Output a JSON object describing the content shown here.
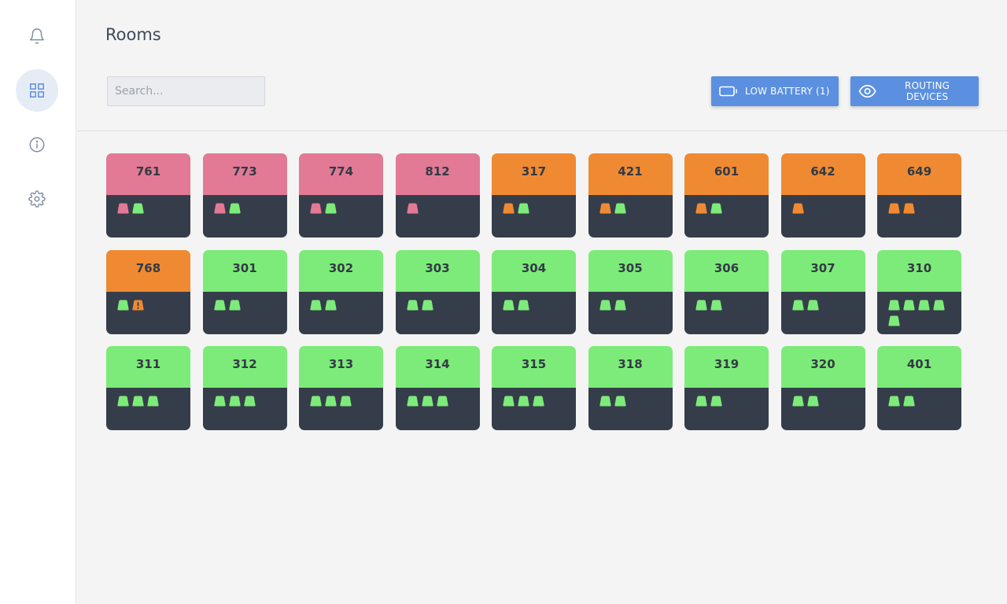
{
  "sidebar": {
    "items": [
      {
        "name": "notifications",
        "icon": "bell-icon",
        "active": false
      },
      {
        "name": "rooms",
        "icon": "grid-icon",
        "active": true
      },
      {
        "name": "info",
        "icon": "info-icon",
        "active": false
      },
      {
        "name": "settings",
        "icon": "gear-icon",
        "active": false
      }
    ]
  },
  "header": {
    "title": "Rooms"
  },
  "search": {
    "placeholder": "Search..."
  },
  "filters": {
    "low_battery": {
      "label": "LOW BATTERY (1)",
      "icon": "battery-icon"
    },
    "routing": {
      "label": "ROUTING DEVICES",
      "icon": "eye-icon"
    }
  },
  "colors": {
    "pink": "#e27a95",
    "orange": "#ef8a32",
    "green": "#7deb79",
    "body": "#363d4a",
    "accent": "#5b8fe0"
  },
  "rooms": [
    {
      "number": "761",
      "status": "pink",
      "devices": [
        "pink",
        "green"
      ]
    },
    {
      "number": "773",
      "status": "pink",
      "devices": [
        "pink",
        "green"
      ]
    },
    {
      "number": "774",
      "status": "pink",
      "devices": [
        "pink",
        "green"
      ]
    },
    {
      "number": "812",
      "status": "pink",
      "devices": [
        "pink"
      ]
    },
    {
      "number": "317",
      "status": "orange",
      "devices": [
        "orange",
        "green"
      ]
    },
    {
      "number": "421",
      "status": "orange",
      "devices": [
        "orange",
        "green"
      ]
    },
    {
      "number": "601",
      "status": "orange",
      "devices": [
        "orange",
        "green"
      ]
    },
    {
      "number": "642",
      "status": "orange",
      "devices": [
        "orange"
      ]
    },
    {
      "number": "649",
      "status": "orange",
      "devices": [
        "orange",
        "orange"
      ]
    },
    {
      "number": "768",
      "status": "orange",
      "devices": [
        "green",
        "warning"
      ]
    },
    {
      "number": "301",
      "status": "green",
      "devices": [
        "green",
        "green"
      ]
    },
    {
      "number": "302",
      "status": "green",
      "devices": [
        "green",
        "green"
      ]
    },
    {
      "number": "303",
      "status": "green",
      "devices": [
        "green",
        "green"
      ]
    },
    {
      "number": "304",
      "status": "green",
      "devices": [
        "green",
        "green"
      ]
    },
    {
      "number": "305",
      "status": "green",
      "devices": [
        "green",
        "green"
      ]
    },
    {
      "number": "306",
      "status": "green",
      "devices": [
        "green",
        "green"
      ]
    },
    {
      "number": "307",
      "status": "green",
      "devices": [
        "green",
        "green"
      ]
    },
    {
      "number": "310",
      "status": "green",
      "devices": [
        "green",
        "green",
        "green",
        "green",
        "green"
      ]
    },
    {
      "number": "311",
      "status": "green",
      "devices": [
        "green",
        "green",
        "green"
      ]
    },
    {
      "number": "312",
      "status": "green",
      "devices": [
        "green",
        "green",
        "green"
      ]
    },
    {
      "number": "313",
      "status": "green",
      "devices": [
        "green",
        "green",
        "green"
      ]
    },
    {
      "number": "314",
      "status": "green",
      "devices": [
        "green",
        "green",
        "green"
      ]
    },
    {
      "number": "315",
      "status": "green",
      "devices": [
        "green",
        "green",
        "green"
      ]
    },
    {
      "number": "318",
      "status": "green",
      "devices": [
        "green",
        "green"
      ]
    },
    {
      "number": "319",
      "status": "green",
      "devices": [
        "green",
        "green"
      ]
    },
    {
      "number": "320",
      "status": "green",
      "devices": [
        "green",
        "green"
      ]
    },
    {
      "number": "401",
      "status": "green",
      "devices": [
        "green",
        "green"
      ]
    }
  ]
}
